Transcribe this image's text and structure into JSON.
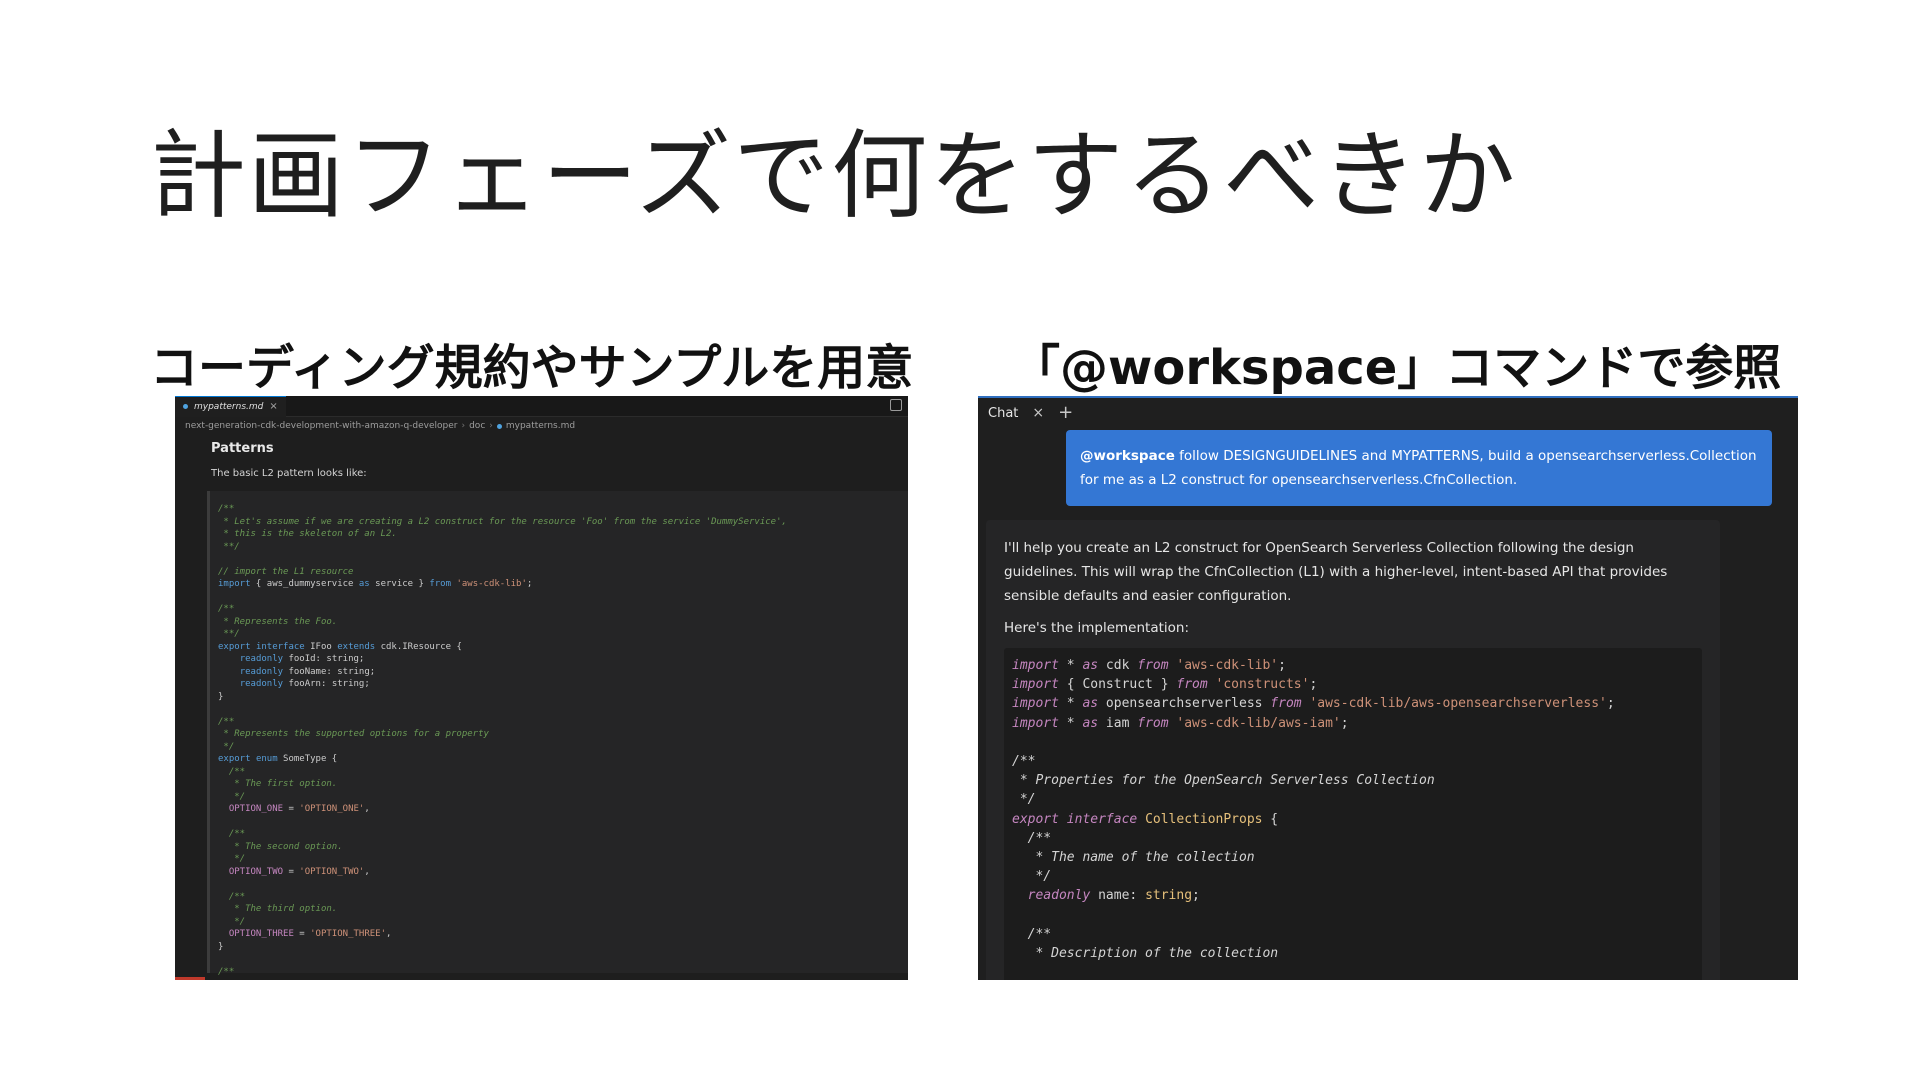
{
  "slide": {
    "title": "計画フェーズで何をするべきか",
    "caption_left": "コーディング規約やサンプルを用意",
    "caption_right": "「@workspace」コマンドで参照"
  },
  "editor": {
    "tab": {
      "label": "mypatterns.md",
      "close": "×"
    },
    "breadcrumb": [
      "next-generation-cdk-development-with-amazon-q-developer",
      "doc",
      "mypatterns.md"
    ],
    "heading": "Patterns",
    "intro": "The basic L2 pattern looks like:",
    "code_lines": [
      "/**",
      " * Let's assume if we are creating a L2 construct for the resource 'Foo' from the service 'DummyService',",
      " * this is the skeleton of an L2.",
      " **/",
      "",
      "// import the L1 resource",
      "import { aws_dummyservice as service } from 'aws-cdk-lib';",
      "",
      "/**",
      " * Represents the Foo.",
      " **/",
      "export interface IFoo extends cdk.IResource {",
      "    readonly fooId: string;",
      "    readonly fooName: string;",
      "    readonly fooArn: string;",
      "}",
      "",
      "/**",
      " * Represents the supported options for a property",
      " */",
      "export enum SomeType {",
      "  /**",
      "   * The first option.",
      "   */",
      "  OPTION_ONE = 'OPTION_ONE',",
      "",
      "  /**",
      "   * The second option.",
      "   */",
      "  OPTION_TWO = 'OPTION_TWO',",
      "",
      "  /**",
      "   * The third option.",
      "   */",
      "  OPTION_THREE = 'OPTION_THREE',",
      "}",
      "",
      "/**"
    ]
  },
  "chat": {
    "tab_label": "Chat",
    "tab_close": "×",
    "tab_add": "+",
    "user_message": {
      "mention": "@workspace",
      "text": " follow DESIGNGUIDELINES and MYPATTERNS, build a opensearchserverless.Collection for me as a L2 construct for opensearchserverless.CfnCollection."
    },
    "assistant_intro": "I'll help you create an L2 construct for OpenSearch Serverless Collection following the design guidelines. This will wrap the CfnCollection (L1) with a higher-level, intent-based API that provides sensible defaults and easier configuration.",
    "implementation_label": "Here's the implementation:",
    "code_lines": [
      "import * as cdk from 'aws-cdk-lib';",
      "import { Construct } from 'constructs';",
      "import * as opensearchserverless from 'aws-cdk-lib/aws-opensearchserverless';",
      "import * as iam from 'aws-cdk-lib/aws-iam';",
      "",
      "/**",
      " * Properties for the OpenSearch Serverless Collection",
      " */",
      "export interface CollectionProps {",
      "  /**",
      "   * The name of the collection",
      "   */",
      "  readonly name: string;",
      "",
      "  /**",
      "   * Description of the collection"
    ]
  }
}
